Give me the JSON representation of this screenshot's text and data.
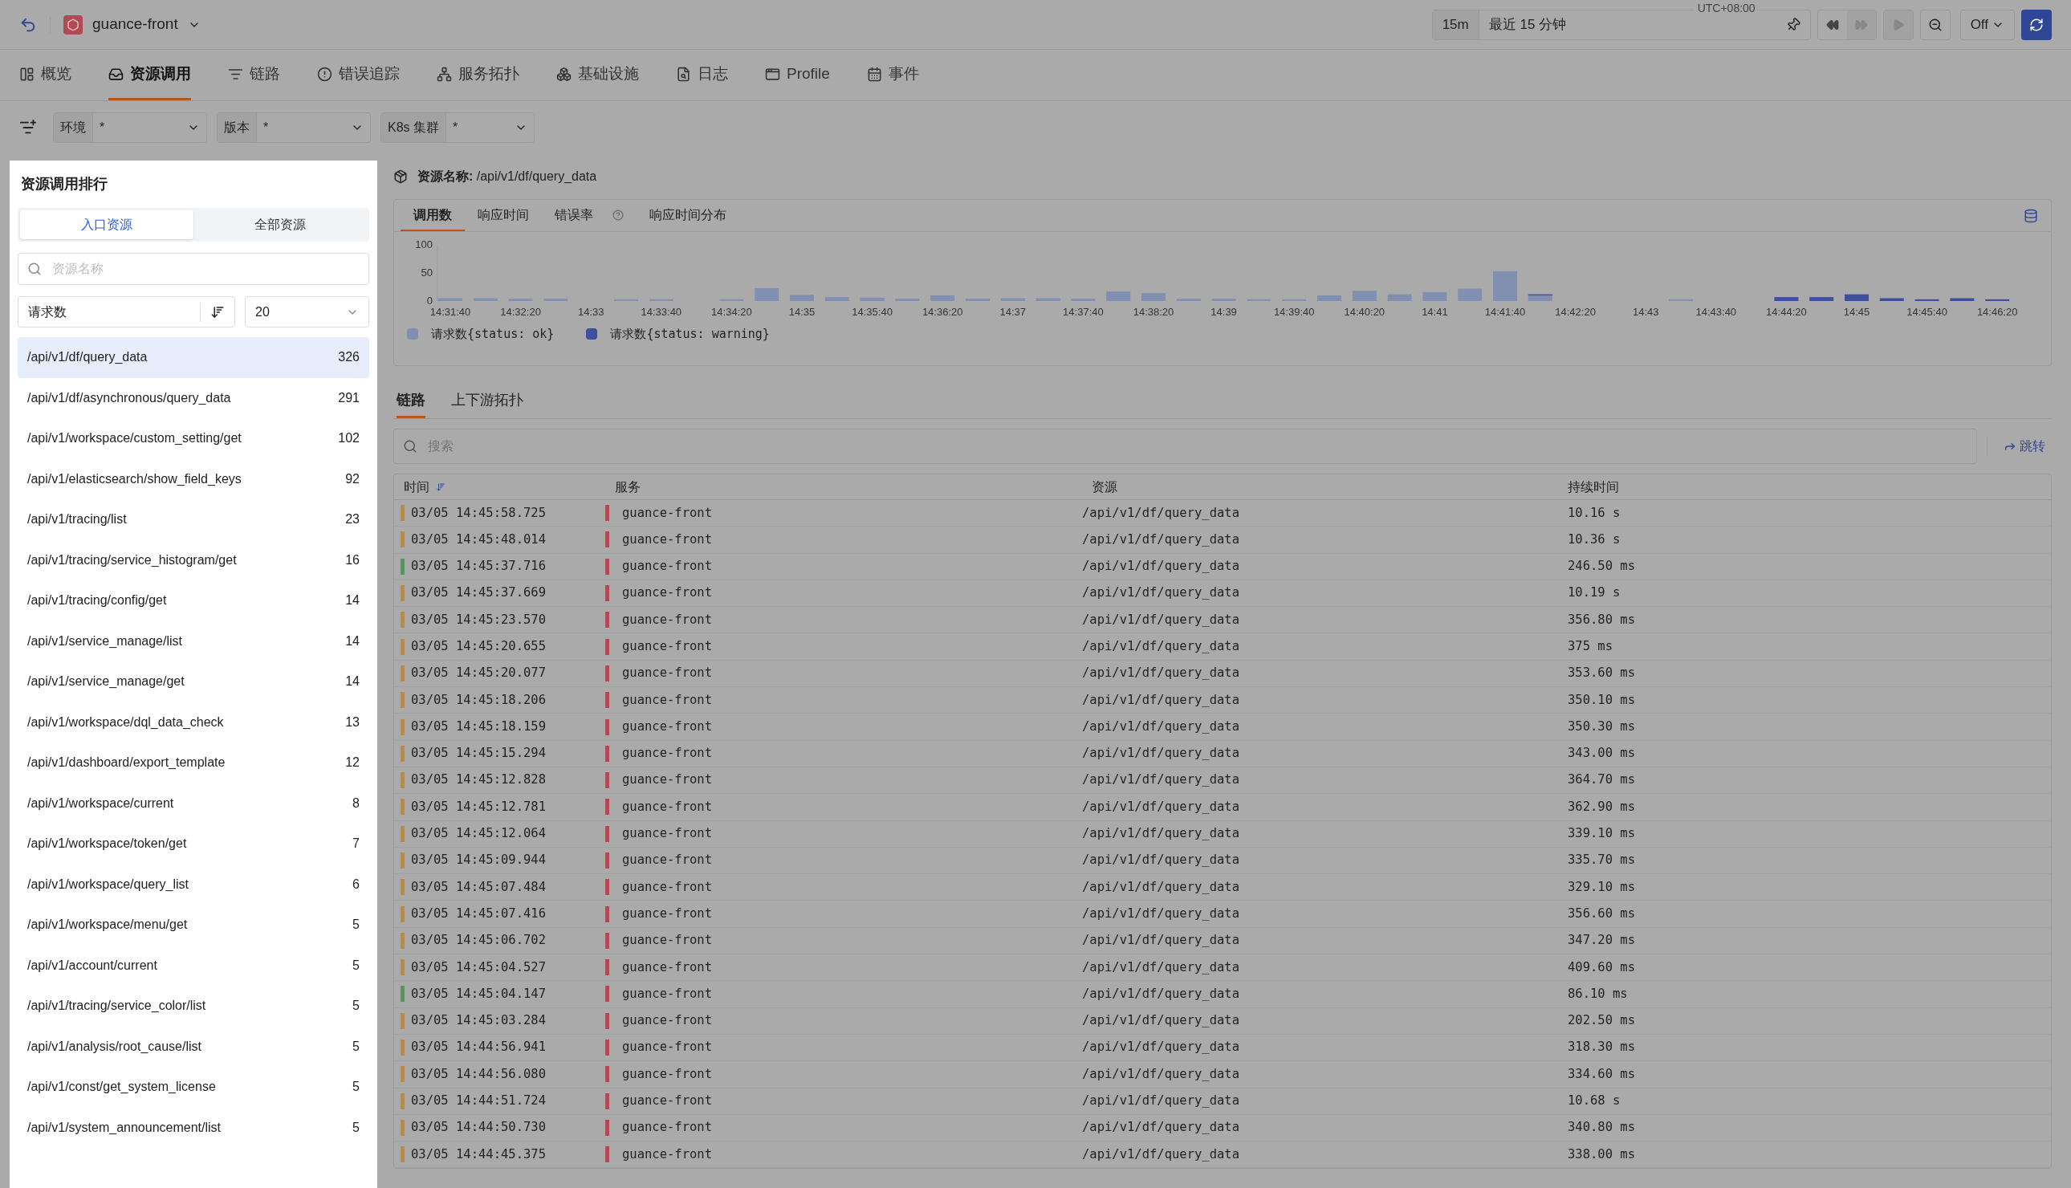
{
  "header": {
    "app_name": "guance-front",
    "time_quick": "15m",
    "time_range": "最近 15 分钟",
    "timezone": "UTC+08:00",
    "auto_refresh": "Off"
  },
  "tabs": [
    {
      "label": "概览",
      "selected": false
    },
    {
      "label": "资源调用",
      "selected": true
    },
    {
      "label": "链路",
      "selected": false
    },
    {
      "label": "错误追踪",
      "selected": false
    },
    {
      "label": "服务拓扑",
      "selected": false
    },
    {
      "label": "基础设施",
      "selected": false
    },
    {
      "label": "日志",
      "selected": false
    },
    {
      "label": "Profile",
      "selected": false
    },
    {
      "label": "事件",
      "selected": false
    }
  ],
  "filters": [
    {
      "label": "环境",
      "value": "*"
    },
    {
      "label": "版本",
      "value": "*"
    },
    {
      "label": "K8s 集群",
      "value": "*"
    }
  ],
  "ranking_panel": {
    "title": "资源调用排行",
    "segments": [
      {
        "label": "入口资源",
        "selected": true
      },
      {
        "label": "全部资源",
        "selected": false
      }
    ],
    "search": {
      "placeholder": "资源名称"
    },
    "sort_by": "请求数",
    "limit": "20",
    "items": [
      {
        "name": "/api/v1/df/query_data",
        "count": "326",
        "selected": true
      },
      {
        "name": "/api/v1/df/asynchronous/query_data",
        "count": "291",
        "selected": false
      },
      {
        "name": "/api/v1/workspace/custom_setting/get",
        "count": "102",
        "selected": false
      },
      {
        "name": "/api/v1/elasticsearch/show_field_keys",
        "count": "92",
        "selected": false
      },
      {
        "name": "/api/v1/tracing/list",
        "count": "23",
        "selected": false
      },
      {
        "name": "/api/v1/tracing/service_histogram/get",
        "count": "16",
        "selected": false
      },
      {
        "name": "/api/v1/tracing/config/get",
        "count": "14",
        "selected": false
      },
      {
        "name": "/api/v1/service_manage/list",
        "count": "14",
        "selected": false
      },
      {
        "name": "/api/v1/service_manage/get",
        "count": "14",
        "selected": false
      },
      {
        "name": "/api/v1/workspace/dql_data_check",
        "count": "13",
        "selected": false
      },
      {
        "name": "/api/v1/dashboard/export_template",
        "count": "12",
        "selected": false
      },
      {
        "name": "/api/v1/workspace/current",
        "count": "8",
        "selected": false
      },
      {
        "name": "/api/v1/workspace/token/get",
        "count": "7",
        "selected": false
      },
      {
        "name": "/api/v1/workspace/query_list",
        "count": "6",
        "selected": false
      },
      {
        "name": "/api/v1/workspace/menu/get",
        "count": "5",
        "selected": false
      },
      {
        "name": "/api/v1/account/current",
        "count": "5",
        "selected": false
      },
      {
        "name": "/api/v1/tracing/service_color/list",
        "count": "5",
        "selected": false
      },
      {
        "name": "/api/v1/analysis/root_cause/list",
        "count": "5",
        "selected": false
      },
      {
        "name": "/api/v1/const/get_system_license",
        "count": "5",
        "selected": false
      },
      {
        "name": "/api/v1/system_announcement/list",
        "count": "5",
        "selected": false
      }
    ]
  },
  "resource": {
    "title": "**资源名称:** /api/v1/df/query_data",
    "chart_tabs": [
      {
        "label": "调用数",
        "selected": true
      },
      {
        "label": "响应时间",
        "selected": false
      },
      {
        "label": "错误率",
        "selected": false,
        "help": true
      },
      {
        "label": "响应时间分布",
        "selected": false
      }
    ],
    "chart_data": {
      "type": "bar",
      "stacked": true,
      "ylim": [
        0,
        100
      ],
      "yticks": [
        0,
        50,
        100
      ],
      "legend": "bottom",
      "categories": [
        "14:31:40",
        null,
        "14:32:20",
        null,
        "14:33",
        null,
        "14:33:40",
        null,
        "14:34:20",
        null,
        "14:35",
        null,
        "14:35:40",
        null,
        "14:36:20",
        null,
        "14:37",
        null,
        "14:37:40",
        null,
        "14:38:20",
        null,
        "14:39",
        null,
        "14:39:40",
        null,
        "14:40:20",
        null,
        "14:41",
        null,
        "14:41:40",
        null,
        "14:42:20",
        null,
        "14:43",
        null,
        "14:43:40",
        null,
        "14:44:20",
        null,
        "14:45",
        null,
        "14:45:40",
        null,
        "14:46:20"
      ],
      "series": [
        {
          "name": "请求数{status: ok}",
          "color": "#8190b0",
          "values": [
            5,
            5,
            4,
            4,
            0,
            3,
            3,
            0,
            3,
            23,
            11,
            7,
            6,
            4,
            10,
            4,
            5,
            5,
            4,
            17,
            14,
            4,
            4,
            3,
            3,
            10,
            18,
            12,
            16,
            22,
            53,
            10,
            0,
            0,
            0,
            3,
            0,
            0,
            0,
            0,
            0,
            0,
            0,
            0,
            0
          ]
        },
        {
          "name": "请求数{status: warning}",
          "color": "#3d4f9e",
          "values": [
            0,
            0,
            0,
            0,
            0,
            0,
            0,
            0,
            0,
            0,
            0,
            0,
            0,
            0,
            0,
            0,
            0,
            0,
            0,
            0,
            0,
            0,
            0,
            0,
            0,
            0,
            0,
            0,
            0,
            0,
            0,
            2,
            0,
            0,
            0,
            0,
            0,
            0,
            7,
            7,
            12,
            5,
            3,
            5,
            3
          ]
        }
      ]
    }
  },
  "trace_tabs": [
    {
      "label": "链路",
      "selected": true
    },
    {
      "label": "上下游拓扑",
      "selected": false
    }
  ],
  "trace_search": {
    "placeholder": "搜索"
  },
  "jump_link": "跳转",
  "table": {
    "columns": [
      "时间",
      "服务",
      "资源",
      "持续时间"
    ],
    "rows": [
      {
        "time": "03/05 14:45:58.725",
        "service": "guance-front",
        "resource": "/api/v1/df/query_data",
        "duration": "10.16 s",
        "color": "#c08a3e"
      },
      {
        "time": "03/05 14:45:48.014",
        "service": "guance-front",
        "resource": "/api/v1/df/query_data",
        "duration": "10.36 s",
        "color": "#c08a3e"
      },
      {
        "time": "03/05 14:45:37.716",
        "service": "guance-front",
        "resource": "/api/v1/df/query_data",
        "duration": "246.50 ms",
        "color": "#4f9a5a"
      },
      {
        "time": "03/05 14:45:37.669",
        "service": "guance-front",
        "resource": "/api/v1/df/query_data",
        "duration": "10.19 s",
        "color": "#c08a3e"
      },
      {
        "time": "03/05 14:45:23.570",
        "service": "guance-front",
        "resource": "/api/v1/df/query_data",
        "duration": "356.80 ms",
        "color": "#c08a3e"
      },
      {
        "time": "03/05 14:45:20.655",
        "service": "guance-front",
        "resource": "/api/v1/df/query_data",
        "duration": "375 ms",
        "color": "#c08a3e"
      },
      {
        "time": "03/05 14:45:20.077",
        "service": "guance-front",
        "resource": "/api/v1/df/query_data",
        "duration": "353.60 ms",
        "color": "#c08a3e"
      },
      {
        "time": "03/05 14:45:18.206",
        "service": "guance-front",
        "resource": "/api/v1/df/query_data",
        "duration": "350.10 ms",
        "color": "#c08a3e"
      },
      {
        "time": "03/05 14:45:18.159",
        "service": "guance-front",
        "resource": "/api/v1/df/query_data",
        "duration": "350.30 ms",
        "color": "#c08a3e"
      },
      {
        "time": "03/05 14:45:15.294",
        "service": "guance-front",
        "resource": "/api/v1/df/query_data",
        "duration": "343.00 ms",
        "color": "#c08a3e"
      },
      {
        "time": "03/05 14:45:12.828",
        "service": "guance-front",
        "resource": "/api/v1/df/query_data",
        "duration": "364.70 ms",
        "color": "#c08a3e"
      },
      {
        "time": "03/05 14:45:12.781",
        "service": "guance-front",
        "resource": "/api/v1/df/query_data",
        "duration": "362.90 ms",
        "color": "#c08a3e"
      },
      {
        "time": "03/05 14:45:12.064",
        "service": "guance-front",
        "resource": "/api/v1/df/query_data",
        "duration": "339.10 ms",
        "color": "#c08a3e"
      },
      {
        "time": "03/05 14:45:09.944",
        "service": "guance-front",
        "resource": "/api/v1/df/query_data",
        "duration": "335.70 ms",
        "color": "#c08a3e"
      },
      {
        "time": "03/05 14:45:07.484",
        "service": "guance-front",
        "resource": "/api/v1/df/query_data",
        "duration": "329.10 ms",
        "color": "#c08a3e"
      },
      {
        "time": "03/05 14:45:07.416",
        "service": "guance-front",
        "resource": "/api/v1/df/query_data",
        "duration": "356.60 ms",
        "color": "#c08a3e"
      },
      {
        "time": "03/05 14:45:06.702",
        "service": "guance-front",
        "resource": "/api/v1/df/query_data",
        "duration": "347.20 ms",
        "color": "#c08a3e"
      },
      {
        "time": "03/05 14:45:04.527",
        "service": "guance-front",
        "resource": "/api/v1/df/query_data",
        "duration": "409.60 ms",
        "color": "#c08a3e"
      },
      {
        "time": "03/05 14:45:04.147",
        "service": "guance-front",
        "resource": "/api/v1/df/query_data",
        "duration": "86.10 ms",
        "color": "#4f9a5a"
      },
      {
        "time": "03/05 14:45:03.284",
        "service": "guance-front",
        "resource": "/api/v1/df/query_data",
        "duration": "202.50 ms",
        "color": "#c08a3e"
      },
      {
        "time": "03/05 14:44:56.941",
        "service": "guance-front",
        "resource": "/api/v1/df/query_data",
        "duration": "318.30 ms",
        "color": "#c08a3e"
      },
      {
        "time": "03/05 14:44:56.080",
        "service": "guance-front",
        "resource": "/api/v1/df/query_data",
        "duration": "334.60 ms",
        "color": "#c08a3e"
      },
      {
        "time": "03/05 14:44:51.724",
        "service": "guance-front",
        "resource": "/api/v1/df/query_data",
        "duration": "10.68 s",
        "color": "#c08a3e"
      },
      {
        "time": "03/05 14:44:50.730",
        "service": "guance-front",
        "resource": "/api/v1/df/query_data",
        "duration": "340.80 ms",
        "color": "#c08a3e"
      },
      {
        "time": "03/05 14:44:45.375",
        "service": "guance-front",
        "resource": "/api/v1/df/query_data",
        "duration": "338.00 ms",
        "color": "#c08a3e"
      }
    ]
  }
}
